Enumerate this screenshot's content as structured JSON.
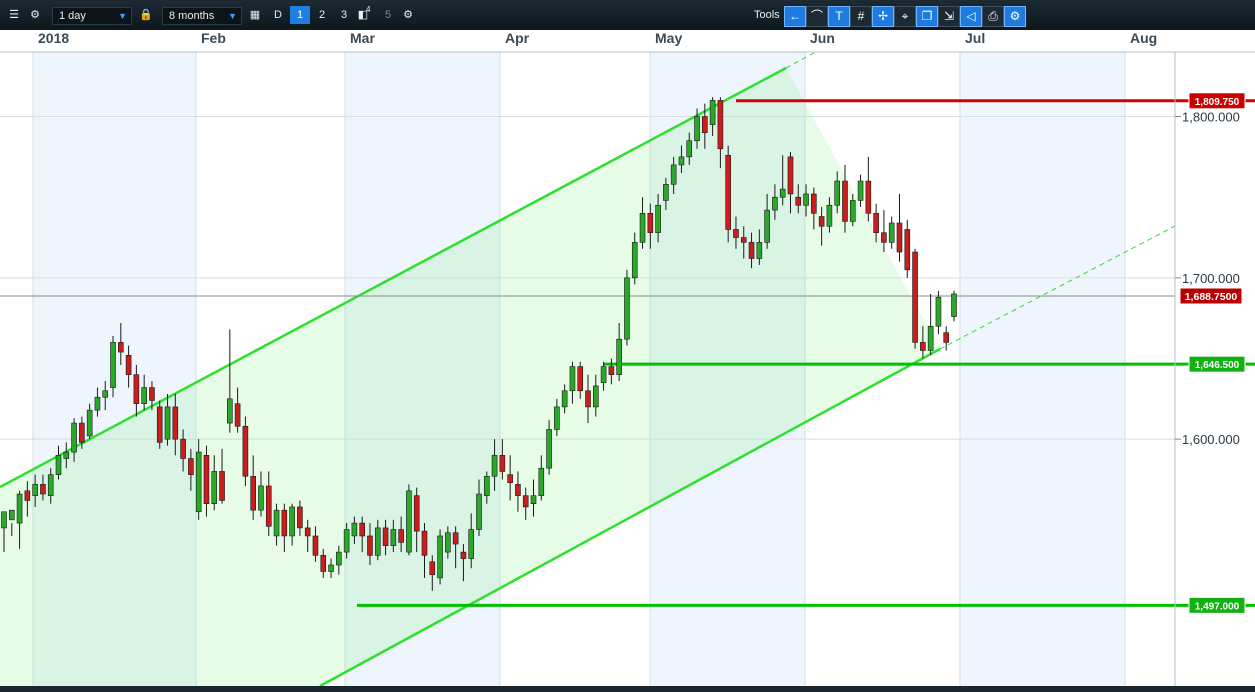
{
  "toolbar": {
    "interval": "1 day",
    "range": "8 months",
    "periods": [
      "D",
      "1",
      "2",
      "3",
      "4",
      "5"
    ],
    "tools_label": "Tools"
  },
  "chart_data": {
    "type": "candlestick",
    "x_labels": [
      "2018",
      "Feb",
      "Mar",
      "Apr",
      "May",
      "Jun",
      "Jul",
      "Aug"
    ],
    "y_ticks": [
      "1,800.000",
      "1,700.000",
      "1,600.000"
    ],
    "ylim": [
      1447,
      1840
    ],
    "current_price_label": "1,688.7500",
    "current_price": 1688.75,
    "horizontal_levels": [
      {
        "label": "1,809.750",
        "value": 1809.75,
        "color": "#d40000"
      },
      {
        "label": "1,646.500",
        "value": 1646.5,
        "color": "#00c000"
      },
      {
        "label": "1,497.000",
        "value": 1497,
        "color": "#00c000"
      }
    ],
    "candles": [
      [
        1545,
        1555,
        1530,
        1550
      ],
      [
        1550,
        1556,
        1540,
        1548
      ],
      [
        1548,
        1566,
        1532,
        1568
      ],
      [
        1568,
        1562,
        1552,
        1574
      ],
      [
        1565,
        1572,
        1558,
        1578
      ],
      [
        1572,
        1566,
        1562,
        1578
      ],
      [
        1565,
        1578,
        1560,
        1582
      ],
      [
        1578,
        1590,
        1575,
        1596
      ],
      [
        1588,
        1592,
        1582,
        1598
      ],
      [
        1592,
        1610,
        1586,
        1613
      ],
      [
        1610,
        1598,
        1594,
        1614
      ],
      [
        1602,
        1618,
        1600,
        1622
      ],
      [
        1618,
        1626,
        1614,
        1632
      ],
      [
        1626,
        1630,
        1618,
        1636
      ],
      [
        1632,
        1660,
        1626,
        1664
      ],
      [
        1660,
        1654,
        1646,
        1672
      ],
      [
        1652,
        1640,
        1632,
        1658
      ],
      [
        1640,
        1622,
        1614,
        1646
      ],
      [
        1622,
        1632,
        1618,
        1640
      ],
      [
        1632,
        1624,
        1618,
        1636
      ],
      [
        1620,
        1598,
        1594,
        1624
      ],
      [
        1600,
        1620,
        1596,
        1628
      ],
      [
        1620,
        1600,
        1590,
        1628
      ],
      [
        1600,
        1588,
        1580,
        1606
      ],
      [
        1588,
        1578,
        1568,
        1594
      ],
      [
        1555,
        1592,
        1550,
        1600
      ],
      [
        1590,
        1560,
        1552,
        1596
      ],
      [
        1560,
        1580,
        1556,
        1590
      ],
      [
        1580,
        1562,
        1560,
        1594
      ],
      [
        1610,
        1625,
        1604,
        1668
      ],
      [
        1622,
        1608,
        1604,
        1632
      ],
      [
        1608,
        1577,
        1571,
        1614
      ],
      [
        1577,
        1556,
        1550,
        1590
      ],
      [
        1556,
        1571,
        1552,
        1580
      ],
      [
        1571,
        1546,
        1540,
        1580
      ],
      [
        1540,
        1556,
        1534,
        1560
      ],
      [
        1556,
        1540,
        1530,
        1560
      ],
      [
        1540,
        1558,
        1534,
        1560
      ],
      [
        1558,
        1545,
        1540,
        1562
      ],
      [
        1545,
        1540,
        1530,
        1550
      ],
      [
        1540,
        1528,
        1524,
        1546
      ],
      [
        1528,
        1518,
        1514,
        1532
      ],
      [
        1518,
        1522,
        1514,
        1526
      ],
      [
        1522,
        1530,
        1516,
        1534
      ],
      [
        1530,
        1544,
        1526,
        1548
      ],
      [
        1540,
        1548,
        1535,
        1552
      ],
      [
        1548,
        1540,
        1530,
        1552
      ],
      [
        1540,
        1528,
        1522,
        1548
      ],
      [
        1528,
        1545,
        1525,
        1550
      ],
      [
        1545,
        1534,
        1528,
        1550
      ],
      [
        1534,
        1544,
        1530,
        1550
      ],
      [
        1544,
        1536,
        1530,
        1552
      ],
      [
        1530,
        1568,
        1528,
        1572
      ],
      [
        1565,
        1543,
        1530,
        1570
      ],
      [
        1543,
        1528,
        1514,
        1548
      ],
      [
        1524,
        1516,
        1506,
        1528
      ],
      [
        1514,
        1540,
        1510,
        1544
      ],
      [
        1530,
        1542,
        1526,
        1546
      ],
      [
        1542,
        1535,
        1520,
        1546
      ],
      [
        1530,
        1526,
        1512,
        1535
      ],
      [
        1526,
        1544,
        1520,
        1554
      ],
      [
        1544,
        1566,
        1540,
        1575
      ],
      [
        1565,
        1577,
        1560,
        1580
      ],
      [
        1577,
        1590,
        1568,
        1600
      ],
      [
        1590,
        1580,
        1575,
        1600
      ],
      [
        1578,
        1573,
        1562,
        1590
      ],
      [
        1572,
        1565,
        1555,
        1580
      ],
      [
        1565,
        1558,
        1550,
        1570
      ],
      [
        1560,
        1565,
        1552,
        1575
      ],
      [
        1565,
        1582,
        1562,
        1590
      ],
      [
        1582,
        1606,
        1578,
        1612
      ],
      [
        1606,
        1620,
        1602,
        1625
      ],
      [
        1620,
        1630,
        1616,
        1634
      ],
      [
        1630,
        1645,
        1622,
        1648
      ],
      [
        1645,
        1630,
        1625,
        1648
      ],
      [
        1630,
        1620,
        1610,
        1640
      ],
      [
        1620,
        1633,
        1614,
        1640
      ],
      [
        1635,
        1645,
        1630,
        1648
      ],
      [
        1645,
        1640,
        1634,
        1650
      ],
      [
        1640,
        1662,
        1636,
        1672
      ],
      [
        1662,
        1700,
        1658,
        1705
      ],
      [
        1700,
        1722,
        1696,
        1728
      ],
      [
        1722,
        1740,
        1718,
        1750
      ],
      [
        1740,
        1728,
        1718,
        1746
      ],
      [
        1728,
        1745,
        1722,
        1752
      ],
      [
        1748,
        1758,
        1742,
        1762
      ],
      [
        1758,
        1770,
        1752,
        1775
      ],
      [
        1770,
        1775,
        1765,
        1782
      ],
      [
        1775,
        1785,
        1770,
        1790
      ],
      [
        1785,
        1800,
        1780,
        1805
      ],
      [
        1800,
        1790,
        1780,
        1808
      ],
      [
        1795,
        1810,
        1788,
        1812
      ],
      [
        1810,
        1780,
        1768,
        1812
      ],
      [
        1776,
        1730,
        1722,
        1782
      ],
      [
        1730,
        1725,
        1718,
        1738
      ],
      [
        1725,
        1722,
        1712,
        1732
      ],
      [
        1722,
        1712,
        1706,
        1728
      ],
      [
        1712,
        1722,
        1708,
        1730
      ],
      [
        1722,
        1742,
        1718,
        1752
      ],
      [
        1742,
        1750,
        1736,
        1758
      ],
      [
        1750,
        1755,
        1745,
        1776
      ],
      [
        1775,
        1752,
        1740,
        1778
      ],
      [
        1750,
        1745,
        1740,
        1758
      ],
      [
        1745,
        1752,
        1738,
        1758
      ],
      [
        1752,
        1740,
        1730,
        1756
      ],
      [
        1738,
        1732,
        1720,
        1744
      ],
      [
        1732,
        1745,
        1728,
        1750
      ],
      [
        1745,
        1760,
        1740,
        1766
      ],
      [
        1760,
        1735,
        1728,
        1770
      ],
      [
        1735,
        1748,
        1732,
        1752
      ],
      [
        1748,
        1760,
        1744,
        1764
      ],
      [
        1760,
        1740,
        1735,
        1775
      ],
      [
        1740,
        1728,
        1722,
        1746
      ],
      [
        1728,
        1722,
        1716,
        1742
      ],
      [
        1722,
        1734,
        1718,
        1738
      ],
      [
        1734,
        1716,
        1710,
        1752
      ],
      [
        1730,
        1705,
        1700,
        1736
      ],
      [
        1716,
        1660,
        1656,
        1718
      ],
      [
        1660,
        1655,
        1650,
        1670
      ],
      [
        1655,
        1670,
        1652,
        1690
      ],
      [
        1670,
        1688,
        1665,
        1692
      ],
      [
        1666,
        1660,
        1655,
        1670
      ],
      [
        1676,
        1690,
        1673,
        1692
      ]
    ]
  }
}
